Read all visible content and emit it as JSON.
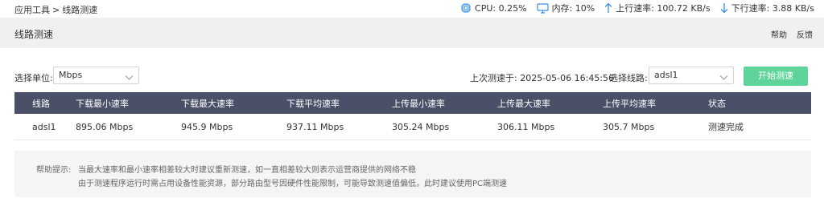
{
  "breadcrumb": {
    "root": "应用工具",
    "separator": ">",
    "current": "线路测速"
  },
  "status": {
    "cpu": "CPU: 0.25%",
    "memory": "内存: 10%",
    "upload": "上行速率: 100.72 KB/s",
    "download": "下行速率: 3.88 KB/s"
  },
  "header": {
    "title": "线路测速",
    "help": "帮助",
    "feedback": "反馈"
  },
  "controls": {
    "unit_label": "选择单位:",
    "unit_value": "Mbps",
    "last_test": "上次测速于: 2025-05-06 16:45:56",
    "line_label": "选择线路:",
    "line_value": "adsl1",
    "start_button": "开始测速"
  },
  "table": {
    "headers": [
      "线路",
      "下载最小速率",
      "下载最大速率",
      "下载平均速率",
      "上传最小速率",
      "上传最大速率",
      "上传平均速率",
      "状态"
    ],
    "rows": [
      [
        "adsl1",
        "895.06 Mbps",
        "945.9 Mbps",
        "937.11 Mbps",
        "305.24 Mbps",
        "306.11 Mbps",
        "305.7 Mbps",
        "测速完成"
      ]
    ]
  },
  "help": {
    "title": "帮助提示:",
    "line1": "当最大速率和最小速率相差较大时建议重新测速，如一直相差较大则表示运营商提供的网络不稳",
    "line2": "由于测速程序运行时需占用设备性能资源，部分路由型号因硬件性能限制，可能导致测速值偏低，此时建议使用PC端测速"
  },
  "colors": {
    "accent_green": "#5fd49a",
    "table_header": "#4a5068",
    "icon_blue": "#3a8ee6"
  }
}
